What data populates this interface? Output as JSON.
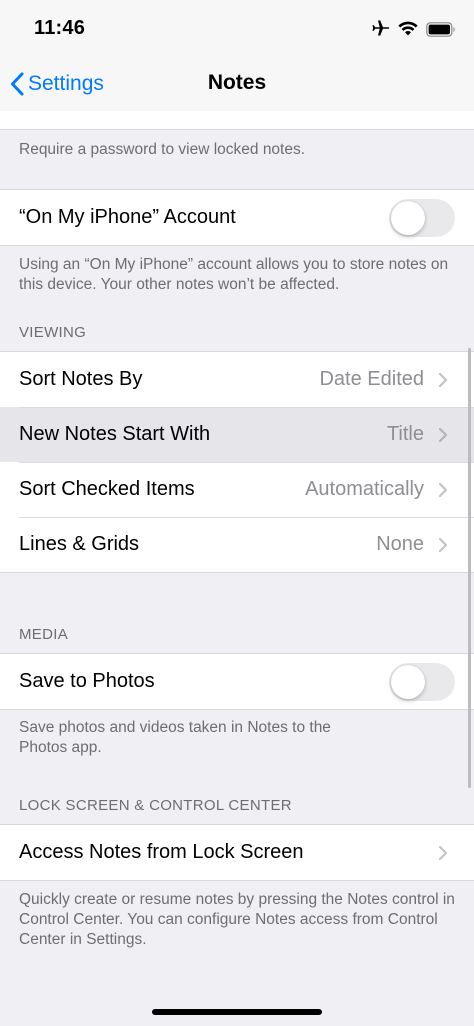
{
  "status_bar": {
    "time": "11:46"
  },
  "nav": {
    "back_label": "Settings",
    "title": "Notes"
  },
  "password_section": {
    "footnote": "Require a password to view locked notes."
  },
  "on_my_iphone": {
    "label": "“On My iPhone” Account",
    "enabled": false,
    "footnote": "Using an “On My iPhone” account allows you to store notes on this device. Your other notes won’t be affected."
  },
  "viewing": {
    "header": "VIEWING",
    "rows": [
      {
        "label": "Sort Notes By",
        "value": "Date Edited"
      },
      {
        "label": "New Notes Start With",
        "value": "Title"
      },
      {
        "label": "Sort Checked Items",
        "value": "Automatically"
      },
      {
        "label": "Lines & Grids",
        "value": "None"
      }
    ]
  },
  "media": {
    "header": "MEDIA",
    "save_to_photos": {
      "label": "Save to Photos",
      "enabled": false
    },
    "footnote": "Save photos and videos taken in Notes to the Photos app."
  },
  "lock_screen": {
    "header": "LOCK SCREEN & CONTROL CENTER",
    "row_label": "Access Notes from Lock Screen",
    "footnote": "Quickly create or resume notes by pressing the Notes control in Control Center. You can configure Notes access from Control Center in Settings."
  },
  "colors": {
    "accent": "#007aff",
    "secondary_text": "#6d6d72",
    "value_text": "#8e8e93",
    "background": "#efeff4"
  }
}
